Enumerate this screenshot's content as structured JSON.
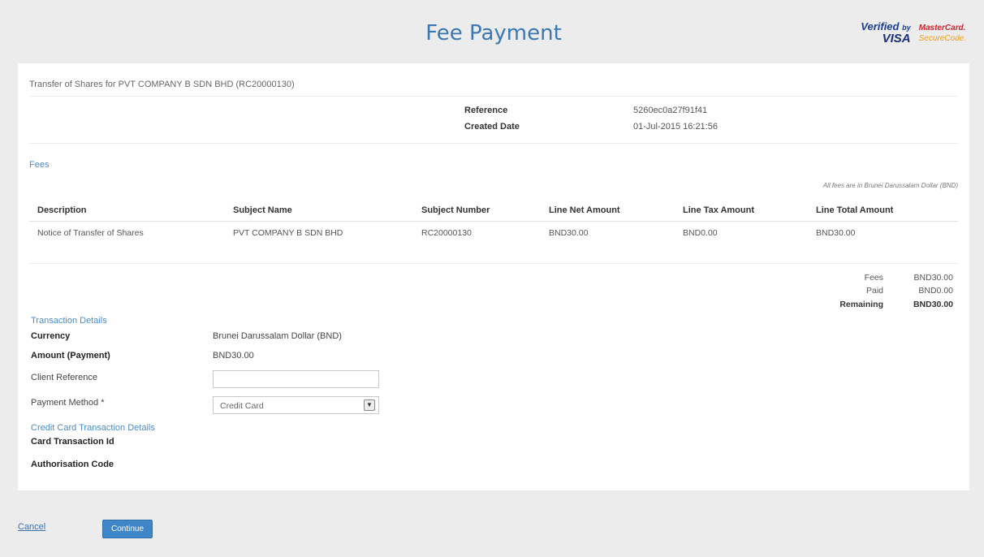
{
  "header": {
    "title": "Fee Payment",
    "visa_logo": {
      "line1": "Verified",
      "line1_small": "by",
      "line2": "VISA"
    },
    "mastercard_logo": {
      "line1": "MasterCard.",
      "line2": "SecureCode."
    }
  },
  "transaction": {
    "subheading": "Transfer of Shares for PVT COMPANY B SDN BHD (RC20000130)",
    "reference_label": "Reference",
    "reference_value": "5260ec0a27f91f41",
    "created_label": "Created Date",
    "created_value": "01-Jul-2015 16:21:56"
  },
  "fees": {
    "section_label": "Fees",
    "currency_note": "All fees are in Brunei Darussalam Dollar (BND)",
    "columns": [
      "Description",
      "Subject Name",
      "Subject Number",
      "Line Net Amount",
      "Line Tax Amount",
      "Line Total Amount"
    ],
    "rows": [
      [
        "Notice of Transfer of Shares",
        "PVT COMPANY B SDN BHD",
        "RC20000130",
        "BND30.00",
        "BND0.00",
        "BND30.00"
      ]
    ],
    "summary": {
      "fees_label": "Fees",
      "fees_value": "BND30.00",
      "paid_label": "Paid",
      "paid_value": "BND0.00",
      "remaining_label": "Remaining",
      "remaining_value": "BND30.00"
    }
  },
  "details": {
    "section_label": "Transaction Details",
    "currency_label": "Currency",
    "currency_value": "Brunei Darussalam Dollar (BND)",
    "amount_label": "Amount (Payment)",
    "amount_value": "BND30.00",
    "client_ref_label": "Client Reference",
    "client_ref_value": "",
    "payment_method_label": "Payment Method *",
    "payment_method_value": "Credit Card"
  },
  "card": {
    "section_label": "Credit Card Transaction Details",
    "txn_id_label": "Card Transaction Id",
    "auth_code_label": "Authorisation Code"
  },
  "actions": {
    "cancel_label": "Cancel",
    "continue_label": "Continue"
  },
  "colors": {
    "accent": "#3a78b5",
    "button": "#3f86c8",
    "background": "#ececec"
  }
}
